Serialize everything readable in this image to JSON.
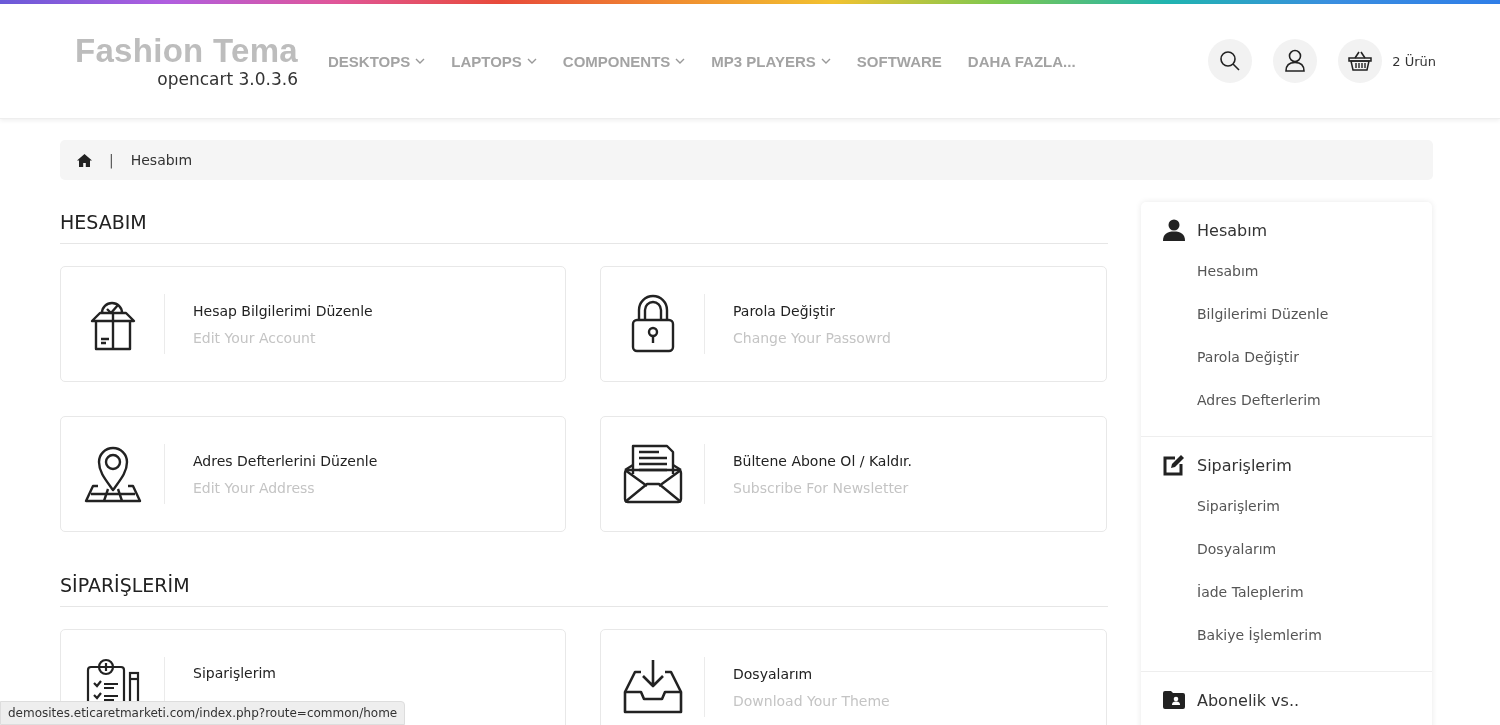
{
  "header": {
    "logo_title": "Fashion Tema",
    "logo_subtitle": "opencart 3.0.3.6",
    "nav": [
      {
        "label": "DESKTOPS",
        "dropdown": true
      },
      {
        "label": "LAPTOPS",
        "dropdown": true
      },
      {
        "label": "COMPONENTS",
        "dropdown": true
      },
      {
        "label": "MP3 PLAYERS",
        "dropdown": true
      },
      {
        "label": "SOFTWARE",
        "dropdown": false
      },
      {
        "label": "DAHA FAZLA...",
        "dropdown": false
      }
    ],
    "cart_label": "2 Ürün"
  },
  "breadcrumb": {
    "separator": "|",
    "items": [
      "Hesabım"
    ]
  },
  "sections": [
    {
      "title": "HESABIM",
      "cards": [
        {
          "kind": "box",
          "title": "Hesap Bilgilerimi Düzenle",
          "subtitle": "Edit Your Account"
        },
        {
          "kind": "lock",
          "title": "Parola Değiştir",
          "subtitle": "Change Your Passowrd"
        },
        {
          "kind": "pin",
          "title": "Adres Defterlerini Düzenle",
          "subtitle": "Edit Your Address"
        },
        {
          "kind": "mail",
          "title": "Bültene Abone Ol / Kaldır.",
          "subtitle": "Subscribe For Newsletter"
        }
      ]
    },
    {
      "title": "SİPARİŞLERİM",
      "cards": [
        {
          "kind": "clipboard",
          "title": "Siparişlerim"
        },
        {
          "kind": "download",
          "title": "Dosyalarım",
          "subtitle": "Download Your Theme"
        }
      ]
    }
  ],
  "sidebar": {
    "groups": [
      {
        "kind": "user",
        "title": "Hesabım",
        "items": [
          "Hesabım",
          "Bilgilerimi Düzenle",
          "Parola Değiştir",
          "Adres Defterlerim"
        ]
      },
      {
        "kind": "edit",
        "title": "Siparişlerim",
        "items": [
          "Siparişlerim",
          "Dosyalarım",
          "İade Taleplerim",
          "Bakiye İşlemlerim"
        ]
      },
      {
        "kind": "folder",
        "title": "Abonelik vs.."
      }
    ]
  },
  "status_bar": "demosites.eticaretmarketi.com/index.php?route=common/home"
}
